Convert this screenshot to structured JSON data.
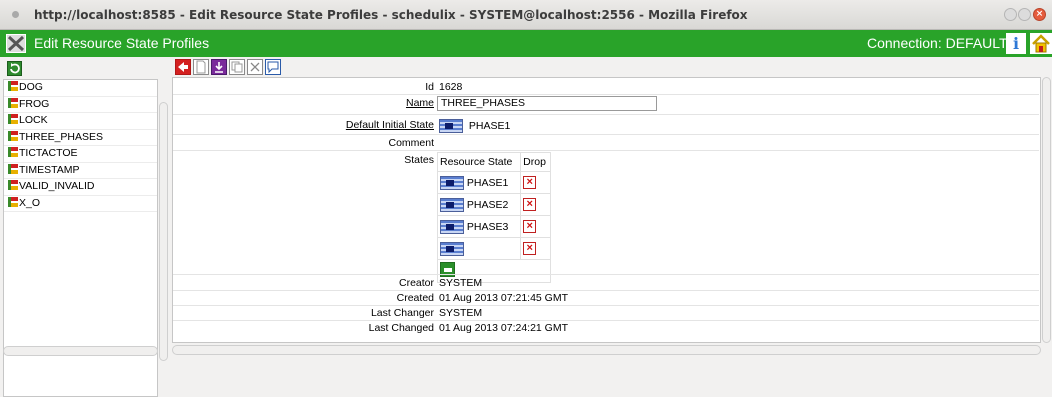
{
  "window": {
    "title": "http://localhost:8585 - Edit Resource State Profiles - schedulix - SYSTEM@localhost:2556 - Mozilla Firefox",
    "close_glyph": "×"
  },
  "app": {
    "title": "Edit Resource State Profiles",
    "connection": "Connection: DEFAULT",
    "info_glyph": "i"
  },
  "tree": {
    "items": [
      {
        "label": "DOG"
      },
      {
        "label": "FROG"
      },
      {
        "label": "LOCK"
      },
      {
        "label": "THREE_PHASES"
      },
      {
        "label": "TICTACTOE"
      },
      {
        "label": "TIMESTAMP"
      },
      {
        "label": "VALID_INVALID"
      },
      {
        "label": "X_O"
      }
    ]
  },
  "form": {
    "id_label": "Id",
    "id_value": "1628",
    "name_label": "Name",
    "name_value": "THREE_PHASES",
    "default_initial_state_label": "Default Initial State",
    "default_initial_state_value": "PHASE1",
    "comment_label": "Comment",
    "states_label": "States",
    "states_table": {
      "col_resource_state": "Resource State",
      "col_drop": "Drop",
      "rows": [
        {
          "state": "PHASE1"
        },
        {
          "state": "PHASE2"
        },
        {
          "state": "PHASE3"
        },
        {
          "state": ""
        }
      ],
      "drop_glyph": "×"
    },
    "creator_label": "Creator",
    "creator_value": "SYSTEM",
    "created_label": "Created",
    "created_value": "01 Aug 2013 07:21:45 GMT",
    "last_changer_label": "Last Changer",
    "last_changer_value": "SYSTEM",
    "last_changed_label": "Last Changed",
    "last_changed_value": "01 Aug 2013 07:24:21 GMT"
  },
  "colors": {
    "app_bar": "#29a329",
    "drop_red": "#d01010",
    "state_icon_blue": "#5a7ed0"
  }
}
